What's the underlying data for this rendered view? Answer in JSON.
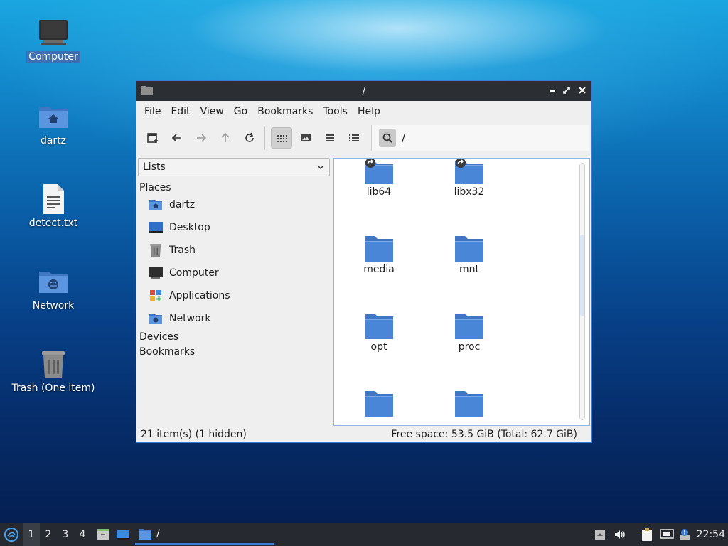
{
  "desktop": {
    "icons": [
      {
        "label": "Computer",
        "icon": "computer-icon"
      },
      {
        "label": "dartz",
        "icon": "home-folder-icon"
      },
      {
        "label": "detect.txt",
        "icon": "text-file-icon"
      },
      {
        "label": "Network",
        "icon": "network-folder-icon"
      },
      {
        "label": "Trash (One item)",
        "icon": "trash-icon"
      }
    ]
  },
  "window": {
    "title": "/",
    "menu": [
      "File",
      "Edit",
      "View",
      "Go",
      "Bookmarks",
      "Tools",
      "Help"
    ],
    "path": "/",
    "side_pane": {
      "mode": "Lists",
      "sections": {
        "places": "Places",
        "devices": "Devices",
        "bookmarks": "Bookmarks"
      },
      "places": [
        {
          "label": "dartz",
          "icon": "home-folder-icon"
        },
        {
          "label": "Desktop",
          "icon": "desktop-icon"
        },
        {
          "label": "Trash",
          "icon": "trash-icon"
        },
        {
          "label": "Computer",
          "icon": "computer-icon"
        },
        {
          "label": "Applications",
          "icon": "applications-icon"
        },
        {
          "label": "Network",
          "icon": "network-folder-icon"
        }
      ]
    },
    "files": [
      {
        "name": "lib64",
        "symlink": true
      },
      {
        "name": "libx32",
        "symlink": true
      },
      {
        "name": "media",
        "symlink": false
      },
      {
        "name": "mnt",
        "symlink": false
      },
      {
        "name": "opt",
        "symlink": false
      },
      {
        "name": "proc",
        "symlink": false
      },
      {
        "name": "",
        "symlink": false
      },
      {
        "name": "",
        "symlink": false
      }
    ],
    "status": {
      "items": "21 item(s) (1 hidden)",
      "free_space": "Free space: 53.5 GiB (Total: 62.7 GiB)"
    }
  },
  "taskbar": {
    "workspaces": [
      "1",
      "2",
      "3",
      "4"
    ],
    "current_workspace": "1",
    "task_label": "/",
    "clock": "22:54"
  },
  "colors": {
    "folder": "#4a86d8",
    "accent": "#3a7bd5",
    "titlebar": "#2b2e33",
    "taskbar": "#262a30"
  }
}
